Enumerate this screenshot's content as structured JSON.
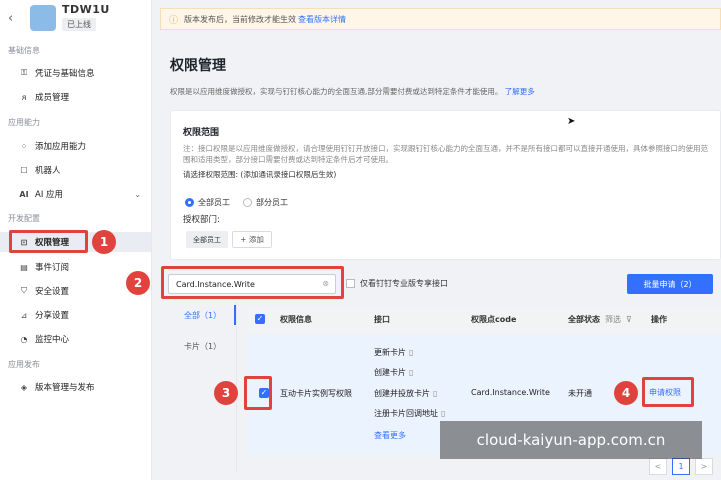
{
  "app": {
    "name": "TDW1U",
    "status_badge": "已上线"
  },
  "sidebar": {
    "sections": {
      "basic": "基础信息",
      "capability": "应用能力",
      "dev": "开发配置",
      "release": "应用发布"
    },
    "items": [
      {
        "label": "凭证与基础信息",
        "icon": "key-icon"
      },
      {
        "label": "成员管理",
        "icon": "user-icon"
      },
      {
        "label": "添加应用能力",
        "icon": "grid-icon"
      },
      {
        "label": "机器人",
        "icon": "robot-icon"
      },
      {
        "label": "AI 应用",
        "icon": "ai-icon"
      },
      {
        "label": "权限管理",
        "icon": "lock-icon",
        "active": true
      },
      {
        "label": "事件订阅",
        "icon": "calendar-icon"
      },
      {
        "label": "安全设置",
        "icon": "shield-icon"
      },
      {
        "label": "分享设置",
        "icon": "share-icon"
      },
      {
        "label": "监控中心",
        "icon": "monitor-icon"
      },
      {
        "label": "版本管理与发布",
        "icon": "version-icon"
      }
    ]
  },
  "notice": {
    "text": "版本发布后，当前修改才能生效",
    "link": "查看版本详情"
  },
  "page": {
    "title": "权限管理",
    "desc": "权限是以应用维度做授权，实现与钉钉核心能力的全面互通,部分需要付费或达到特定条件才能使用。",
    "desc_link": "了解更多"
  },
  "scope": {
    "title": "权限范围",
    "note": "注：接口权限是以应用维度做授权，请合理使用钉钉开放接口，实现跟钉钉核心能力的全面互通，并不是所有接口都可以直接开通使用，具体参照接口的使用范围和适用类型，部分接口需要付费或达到特定条件后才可使用。",
    "question": "请选择权限范围: (添加通讯录接口权限后生效)",
    "options": [
      "全部员工",
      "部分员工"
    ],
    "dept_label": "授权部门:",
    "dept_tag": "全部员工",
    "add_label": "+ 添加"
  },
  "toolbar": {
    "search_value": "Card.Instance.Write",
    "pro_only_label": "仅看钉钉专业版专享接口",
    "batch_button": "批量申请（2）"
  },
  "categories": [
    {
      "label": "全部（1）",
      "active": true
    },
    {
      "label": "卡片（1）",
      "active": false
    }
  ],
  "table": {
    "headers": {
      "perm": "权限信息",
      "iface": "接口",
      "code": "权限点code",
      "status": "全部状态",
      "filter": "筛选",
      "ops": "操作"
    },
    "row": {
      "name": "互动卡片实例写权限",
      "interfaces": [
        "更新卡片",
        "创建卡片",
        "创建并投放卡片",
        "注册卡片回调地址"
      ],
      "more": "查看更多",
      "code": "Card.Instance.Write",
      "status": "未开通",
      "action": "申请权限"
    }
  },
  "pagination": {
    "current": "1",
    "prev": "<",
    "next": ">"
  },
  "annotations": [
    "1",
    "2",
    "3",
    "4"
  ],
  "watermark": "cloud-kaiyun-app.com.cn",
  "colors": {
    "accent": "#3370ff",
    "annotation": "#e0433d",
    "notice_bg": "#fff6e8"
  }
}
